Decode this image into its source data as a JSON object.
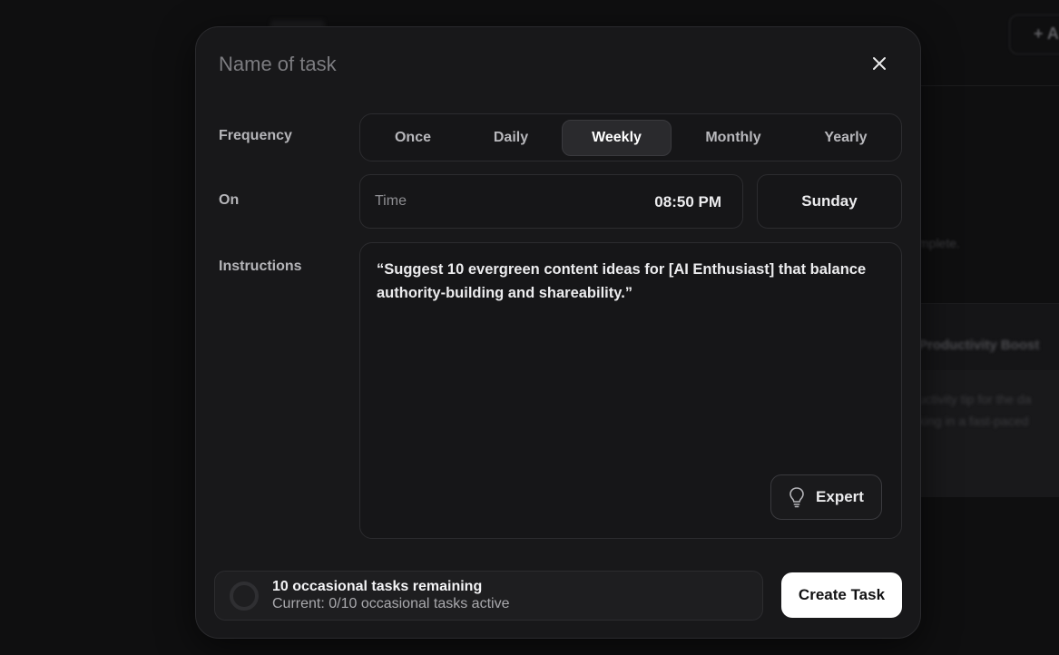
{
  "background": {
    "new_button_label": "+ A",
    "hint_text": "mplete.",
    "card_title": "Productivity Boost",
    "card_body_lines": [
      "uctivity tip for the da",
      "king in a fast-paced"
    ]
  },
  "modal": {
    "name_placeholder": "Name of task",
    "close_icon": "close-icon",
    "frequency": {
      "label": "Frequency",
      "options": [
        "Once",
        "Daily",
        "Weekly",
        "Monthly",
        "Yearly"
      ],
      "selected": "Weekly"
    },
    "schedule": {
      "label": "On",
      "time_label": "Time",
      "time_value": "08:50 PM",
      "day_value": "Sunday"
    },
    "instructions": {
      "label": "Instructions",
      "text": "“Suggest 10 evergreen content ideas for [AI Enthusiast] that balance authority-building and shareability.”",
      "expert_icon": "lightbulb-icon",
      "expert_label": "Expert"
    },
    "quota": {
      "title": "10 occasional tasks remaining",
      "subtitle": "Current: 0/10 occasional tasks active",
      "progress_fraction": 0
    },
    "create_label": "Create Task"
  }
}
